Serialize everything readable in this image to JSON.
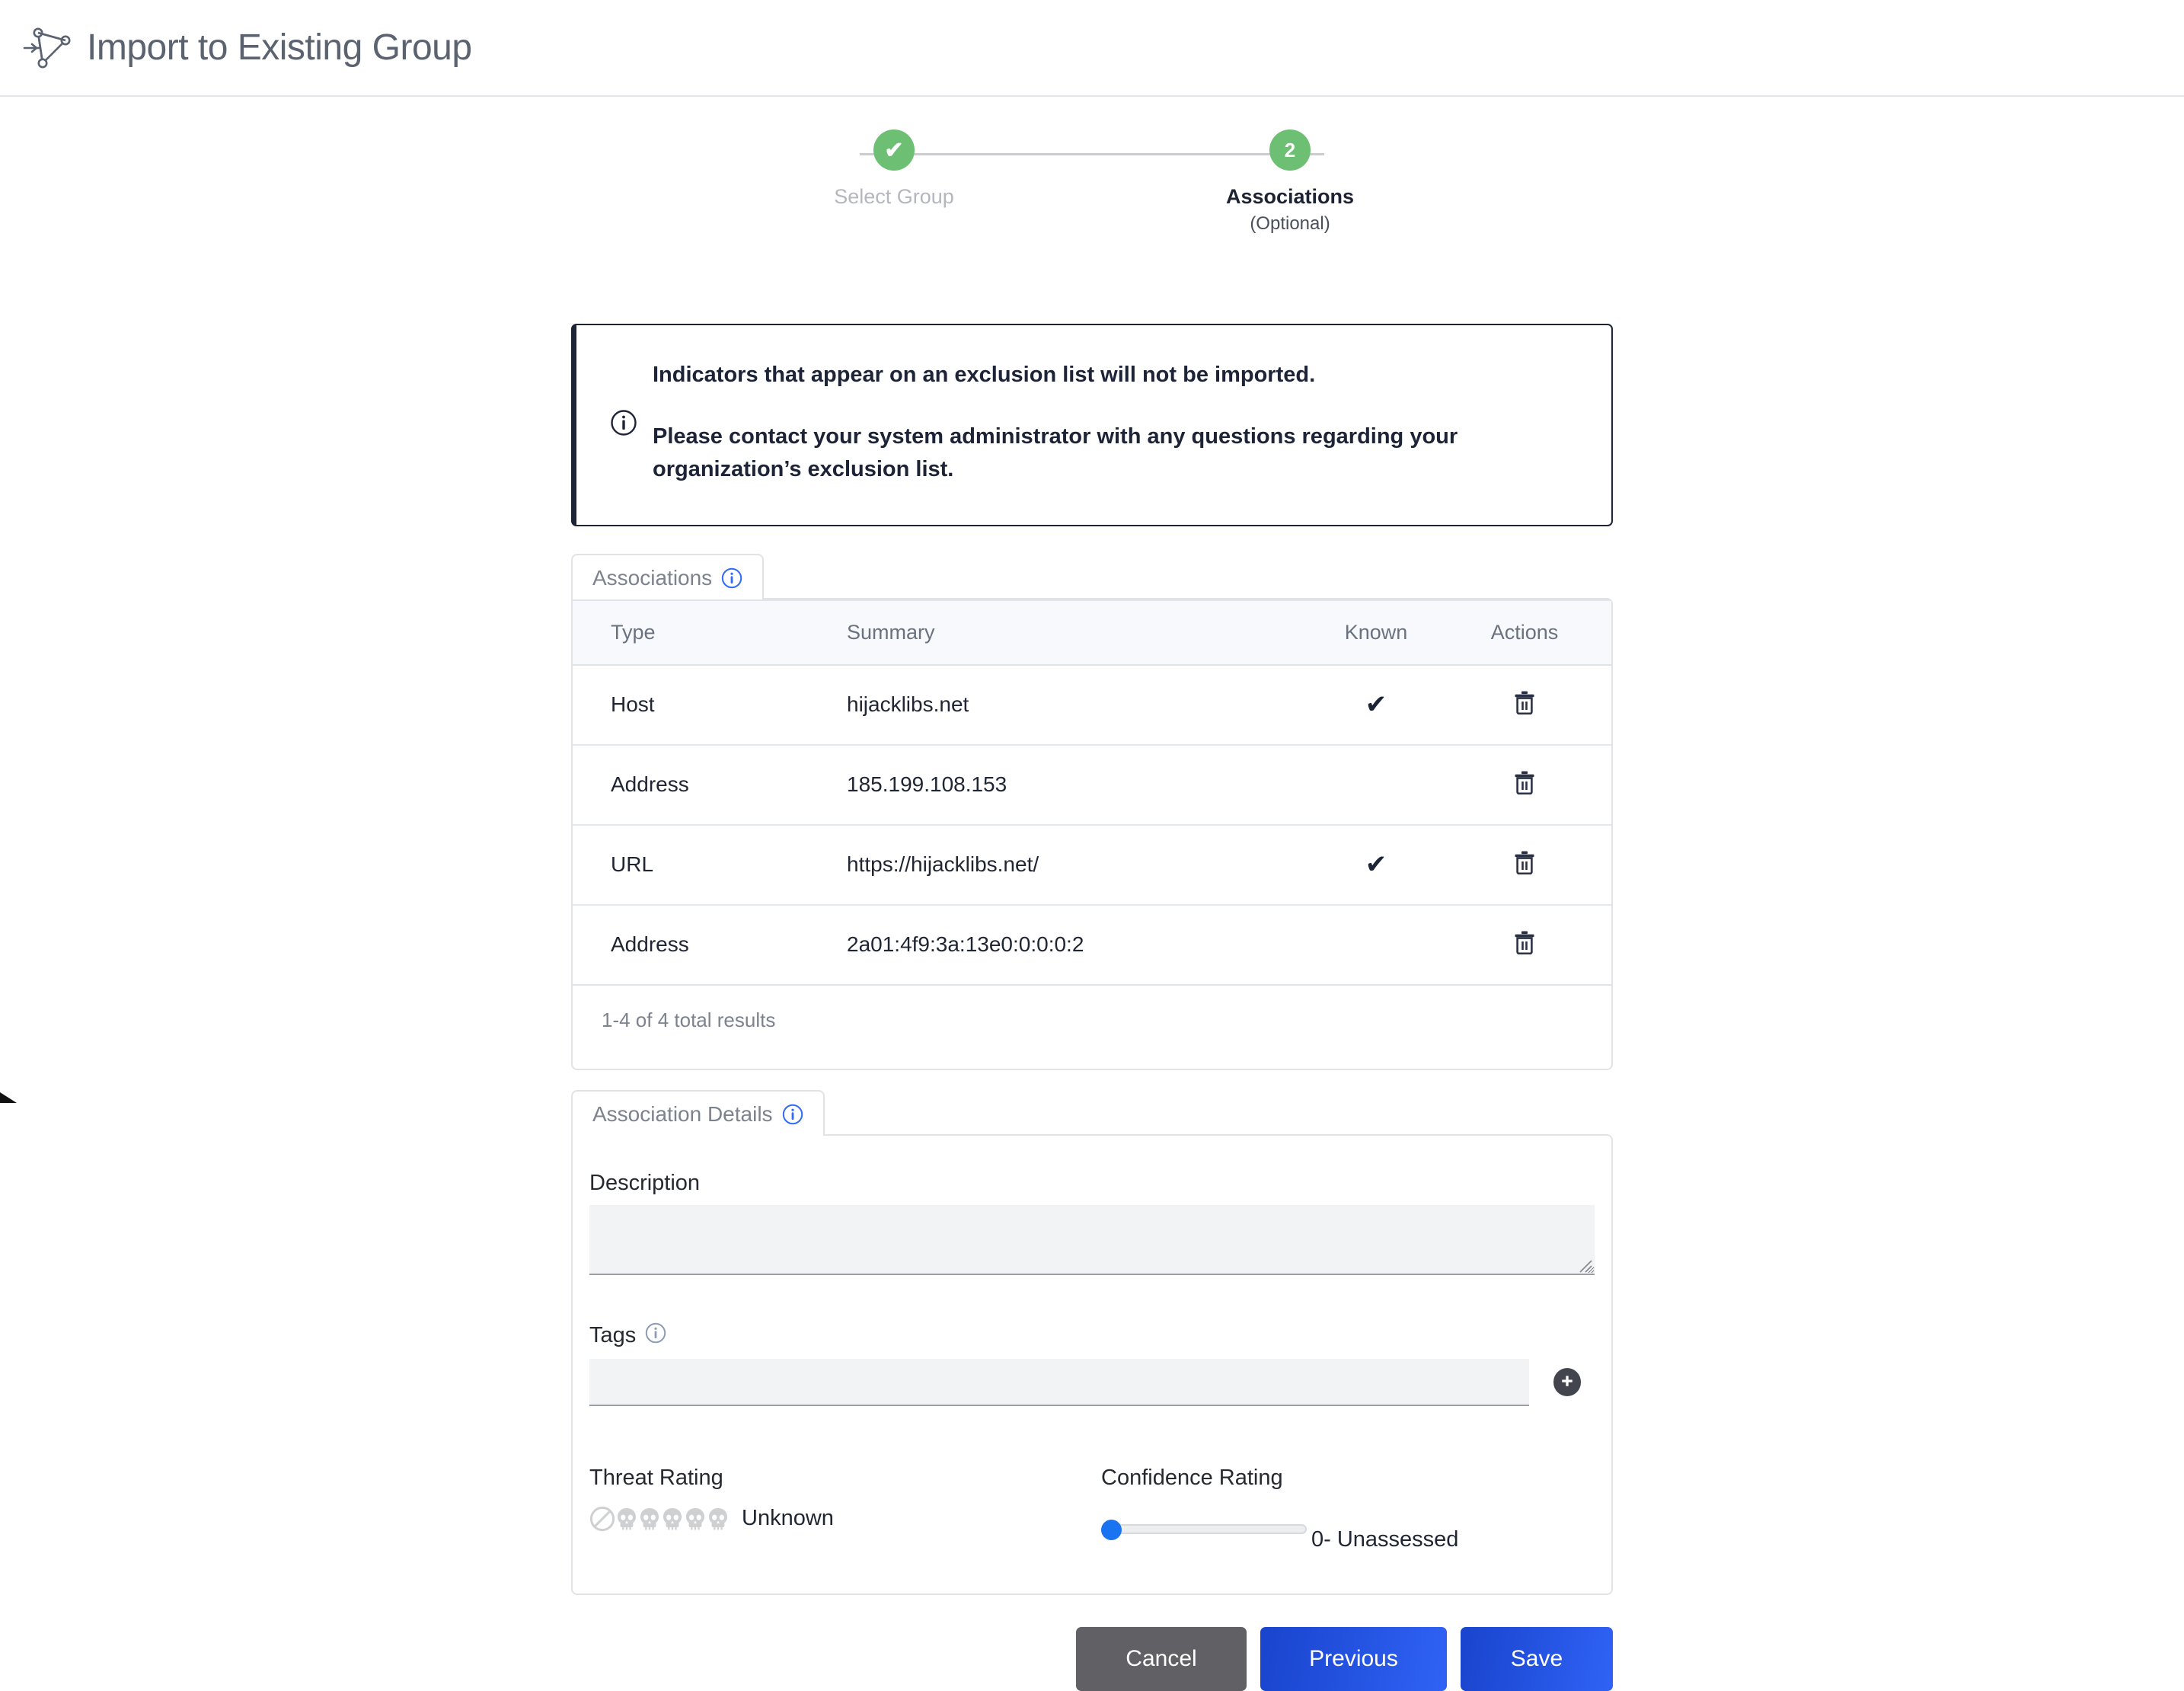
{
  "header": {
    "title": "Import to Existing Group",
    "icon": "group-graph-icon"
  },
  "stepper": {
    "steps": [
      {
        "label": "Select Group",
        "badge": "✔",
        "state": "complete",
        "sub": ""
      },
      {
        "label": "Associations",
        "badge": "2",
        "state": "current",
        "sub": "(Optional)"
      }
    ]
  },
  "alert": {
    "icon": "info-circle-icon",
    "line1": "Indicators that appear on an exclusion list will not be imported.",
    "line2": "Please contact your system administrator with any questions regarding your organization’s exclusion list."
  },
  "associations_tab": {
    "label": "Associations",
    "info_icon": "info-circle-icon"
  },
  "table": {
    "columns": [
      "Type",
      "Summary",
      "Known",
      "Actions"
    ],
    "rows": [
      {
        "type": "Host",
        "summary": "hijacklibs.net",
        "known": "✔",
        "action_icon": "trash-icon"
      },
      {
        "type": "Address",
        "summary": "185.199.108.153",
        "known": "",
        "action_icon": "trash-icon"
      },
      {
        "type": "URL",
        "summary": "https://hijacklibs.net/",
        "known": "✔",
        "action_icon": "trash-icon"
      },
      {
        "type": "Address",
        "summary": "2a01:4f9:3a:13e0:0:0:0:2",
        "known": "",
        "action_icon": "trash-icon"
      }
    ],
    "results_text": "1-4 of 4 total results"
  },
  "details_tab": {
    "label": "Association Details",
    "info_icon": "info-circle-icon"
  },
  "details": {
    "description_label": "Description",
    "description_value": "",
    "tags_label": "Tags",
    "tags_value": "",
    "tags_info_icon": "info-circle-icon",
    "add_tag_icon": "plus-icon",
    "threat_label": "Threat Rating",
    "threat_value": "Unknown",
    "threat_icons": [
      "no-entry-icon",
      "skull-icon",
      "skull-icon",
      "skull-icon",
      "skull-icon",
      "skull-icon"
    ],
    "confidence_label": "Confidence Rating",
    "confidence_value": "0- Unassessed",
    "confidence_slider_position": 0
  },
  "footer": {
    "cancel": "Cancel",
    "previous": "Previous",
    "save": "Save"
  },
  "colors": {
    "step_green": "#6cbf73",
    "alert_border": "#1d2437",
    "primary_blue": "#2f62f5",
    "cancel_gray": "#616165",
    "slider_blue": "#1a73f0"
  }
}
